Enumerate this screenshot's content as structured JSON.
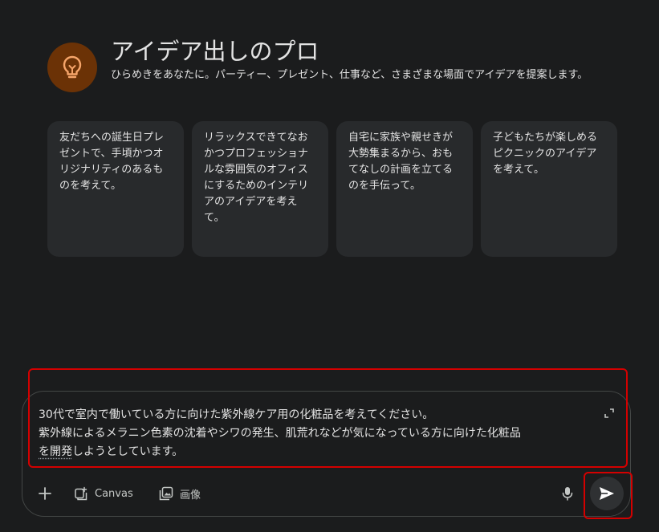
{
  "gem": {
    "title": "アイデア出しのプロ",
    "description": "ひらめきをあなたに。パーティー、プレゼント、仕事など、さまざまな場面でアイデアを提案します。",
    "icon": "lightbulb-icon",
    "accent_color": "#6b3206"
  },
  "suggestions": [
    {
      "text": "友だちへの誕生日プレゼントで、手頃かつオリジナリティのあるものを考えて。"
    },
    {
      "text": "リラックスできてなおかつプロフェッショナルな雰囲気のオフィスにするためのインテリアのアイデアを考えて。"
    },
    {
      "text": "自宅に家族や親せきが大勢集まるから、おもてなしの計画を立てるのを手伝って。"
    },
    {
      "text": "子どもたちが楽しめるピクニックのアイデアを考えて。"
    }
  ],
  "prompt": {
    "line1": "30代で室内で働いている方に向けた紫外線ケア用の化粧品を考えてください。",
    "line2": "紫外線によるメラニン色素の沈着やシワの発生、肌荒れなどが気になっている方に向けた化粧品",
    "line3_underlined": "を開発",
    "line3_rest": "しようとしています。"
  },
  "toolbar": {
    "add_icon": "plus-icon",
    "canvas_label": "Canvas",
    "image_label": "画像",
    "mic_icon": "microphone-icon",
    "send_icon": "send-icon"
  },
  "colors": {
    "background": "#1b1c1d",
    "card": "#282a2c",
    "highlight": "#d40000"
  }
}
